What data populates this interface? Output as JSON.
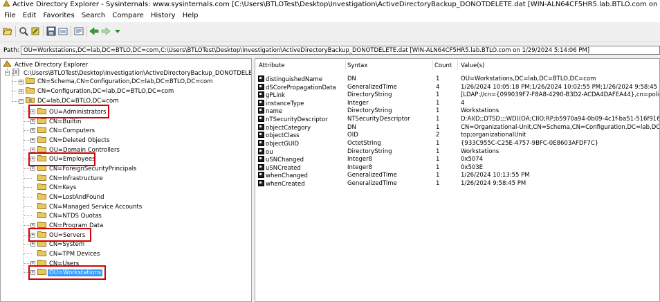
{
  "window": {
    "title": "Active Directory Explorer - Sysinternals: www.sysinternals.com [C:\\Users\\BTLOTest\\Desktop\\Investigation\\ActiveDirectoryBackup_DONOTDELETE.dat [WIN-ALN64CF5HR5.lab.BTLO.com on 1/29/2024 5:14:06 PM]"
  },
  "menu": [
    "File",
    "Edit",
    "Favorites",
    "Search",
    "Compare",
    "History",
    "Help"
  ],
  "path": {
    "label": "Path:",
    "value": "OU=Workstations,DC=lab,DC=BTLO,DC=com,C:\\Users\\BTLOTest\\Desktop\\Investigation\\ActiveDirectoryBackup_DONOTDELETE.dat [WIN-ALN64CF5HR5.lab.BTLO.com on 1/29/2024 5:14:06 PM]"
  },
  "tree": {
    "root": "Active Directory Explorer",
    "file": "C:\\Users\\BTLOTest\\Desktop\\Investigation\\ActiveDirectoryBackup_DONOTDELETE",
    "schema": "CN=Schema,CN=Configuration,DC=lab,DC=BTLO,DC=com",
    "configuration": "CN=Configuration,DC=lab,DC=BTLO,DC=com",
    "domain": "DC=lab,DC=BTLO,DC=com",
    "children": [
      {
        "label": "OU=Administrators",
        "expandable": true
      },
      {
        "label": "CN=Builtin",
        "expandable": true
      },
      {
        "label": "CN=Computers",
        "expandable": true
      },
      {
        "label": "CN=Deleted Objects",
        "expandable": true
      },
      {
        "label": "OU=Domain Controllers",
        "expandable": true
      },
      {
        "label": "OU=Employees",
        "expandable": true
      },
      {
        "label": "CN=ForeignSecurityPrincipals",
        "expandable": true
      },
      {
        "label": "CN=Infrastructure",
        "expandable": false
      },
      {
        "label": "CN=Keys",
        "expandable": false
      },
      {
        "label": "CN=LostAndFound",
        "expandable": false
      },
      {
        "label": "CN=Managed Service Accounts",
        "expandable": false
      },
      {
        "label": "CN=NTDS Quotas",
        "expandable": false
      },
      {
        "label": "CN=Program Data",
        "expandable": true
      },
      {
        "label": "OU=Servers",
        "expandable": true
      },
      {
        "label": "CN=System",
        "expandable": true
      },
      {
        "label": "CN=TPM Devices",
        "expandable": false
      },
      {
        "label": "CN=Users",
        "expandable": true
      },
      {
        "label": "OU=Workstations",
        "expandable": true
      }
    ],
    "selected": "OU=Workstations"
  },
  "list": {
    "headers": {
      "attribute": "Attribute",
      "syntax": "Syntax",
      "count": "Count",
      "values": "Value(s)"
    },
    "rows": [
      {
        "attribute": "distinguishedName",
        "syntax": "DN",
        "count": "1",
        "value": "OU=Workstations,DC=lab,DC=BTLO,DC=com"
      },
      {
        "attribute": "dSCorePropagationData",
        "syntax": "GeneralizedTime",
        "count": "4",
        "value": "1/26/2024 10:05:18 PM;1/26/2024 10:02:55 PM;1/26/2024 9:58:45 PM"
      },
      {
        "attribute": "gPLink",
        "syntax": "DirectoryString",
        "count": "1",
        "value": "[LDAP://cn={099039F7-F8A8-4290-B3D2-ACDA4DAFEA44},cn=policies"
      },
      {
        "attribute": "instanceType",
        "syntax": "Integer",
        "count": "1",
        "value": "4"
      },
      {
        "attribute": "name",
        "syntax": "DirectoryString",
        "count": "1",
        "value": "Workstations"
      },
      {
        "attribute": "nTSecurityDescriptor",
        "syntax": "NTSecurityDescriptor",
        "count": "1",
        "value": "D:AI(D;;DTSD;;;WD)(OA;CIIO;RP;b5970a94-0b09-4c1f-ba51-516f916"
      },
      {
        "attribute": "objectCategory",
        "syntax": "DN",
        "count": "1",
        "value": "CN=Organizational-Unit,CN=Schema,CN=Configuration,DC=lab,DC=BT"
      },
      {
        "attribute": "objectClass",
        "syntax": "OID",
        "count": "2",
        "value": "top;organizationalUnit"
      },
      {
        "attribute": "objectGUID",
        "syntax": "OctetString",
        "count": "1",
        "value": "{933C955C-C25E-4757-9BFC-0E8603AFDF7C}"
      },
      {
        "attribute": "ou",
        "syntax": "DirectoryString",
        "count": "1",
        "value": "Workstations"
      },
      {
        "attribute": "uSNChanged",
        "syntax": "Integer8",
        "count": "1",
        "value": "0x5074"
      },
      {
        "attribute": "uSNCreated",
        "syntax": "Integer8",
        "count": "1",
        "value": "0x503E"
      },
      {
        "attribute": "whenChanged",
        "syntax": "GeneralizedTime",
        "count": "1",
        "value": "1/26/2024 10:13:55 PM"
      },
      {
        "attribute": "whenCreated",
        "syntax": "GeneralizedTime",
        "count": "1",
        "value": "1/26/2024 9:58:45 PM"
      }
    ]
  },
  "highlighted_nodes": [
    "OU=Administrators",
    "OU=Employees",
    "OU=Servers",
    "OU=Workstations"
  ],
  "colors": {
    "highlight": "#d40000",
    "selection": "#3399ff",
    "folder": "#e8c85a"
  }
}
